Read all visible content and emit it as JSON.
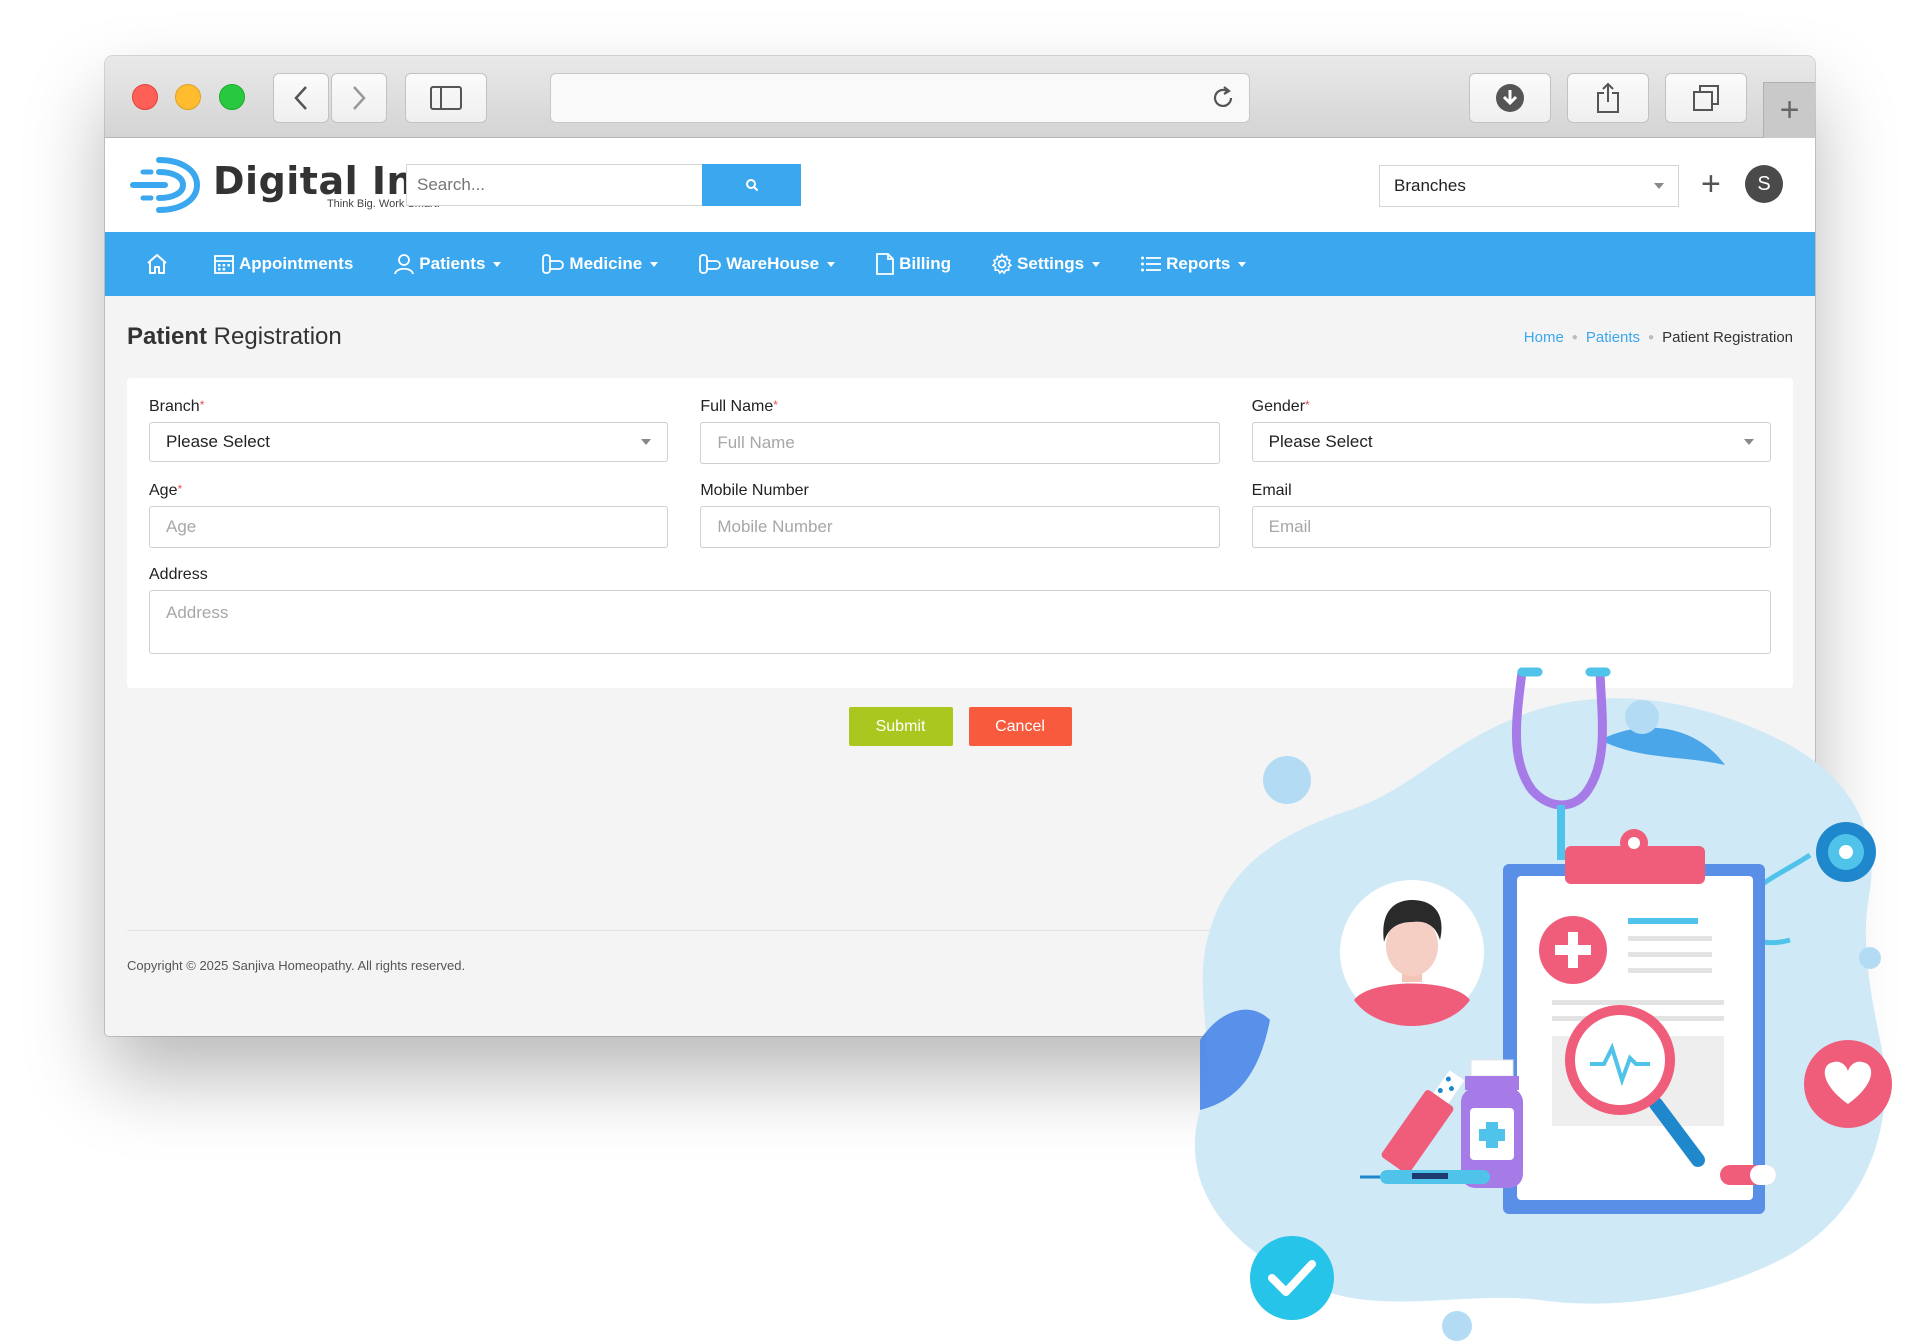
{
  "header": {
    "logo_title": "Digital Ink",
    "logo_tagline": "Think Big. Work Smart.",
    "search_placeholder": "Search...",
    "branches_label": "Branches",
    "user_initial": "S"
  },
  "nav": {
    "items": [
      {
        "label": "Appointments",
        "icon": "calendar-icon",
        "dropdown": false
      },
      {
        "label": "Patients",
        "icon": "user-icon",
        "dropdown": true
      },
      {
        "label": "Medicine",
        "icon": "pill-icon",
        "dropdown": true
      },
      {
        "label": "WareHouse",
        "icon": "pill-icon",
        "dropdown": true
      },
      {
        "label": "Billing",
        "icon": "document-icon",
        "dropdown": false
      },
      {
        "label": "Settings",
        "icon": "gear-icon",
        "dropdown": true
      },
      {
        "label": "Reports",
        "icon": "list-icon",
        "dropdown": true
      }
    ]
  },
  "page": {
    "title_bold": "Patient",
    "title_rest": " Registration",
    "breadcrumb": [
      "Home",
      "Patients",
      "Patient Registration"
    ]
  },
  "form": {
    "branch": {
      "label": "Branch",
      "required": "*",
      "value": "Please Select"
    },
    "full_name": {
      "label": "Full Name",
      "required": "*",
      "placeholder": "Full Name"
    },
    "gender": {
      "label": "Gender",
      "required": "*",
      "value": "Please Select"
    },
    "age": {
      "label": "Age",
      "required": "*",
      "placeholder": "Age"
    },
    "mobile": {
      "label": "Mobile Number",
      "placeholder": "Mobile Number"
    },
    "email": {
      "label": "Email",
      "placeholder": "Email"
    },
    "address": {
      "label": "Address",
      "placeholder": "Address"
    },
    "submit_label": "Submit",
    "cancel_label": "Cancel"
  },
  "footer": {
    "copyright": "Copyright © 2025 Sanjiva Homeopathy. All rights reserved."
  },
  "colors": {
    "primary": "#3aa7ef",
    "submit": "#a9c71e",
    "cancel": "#f75a3c"
  }
}
